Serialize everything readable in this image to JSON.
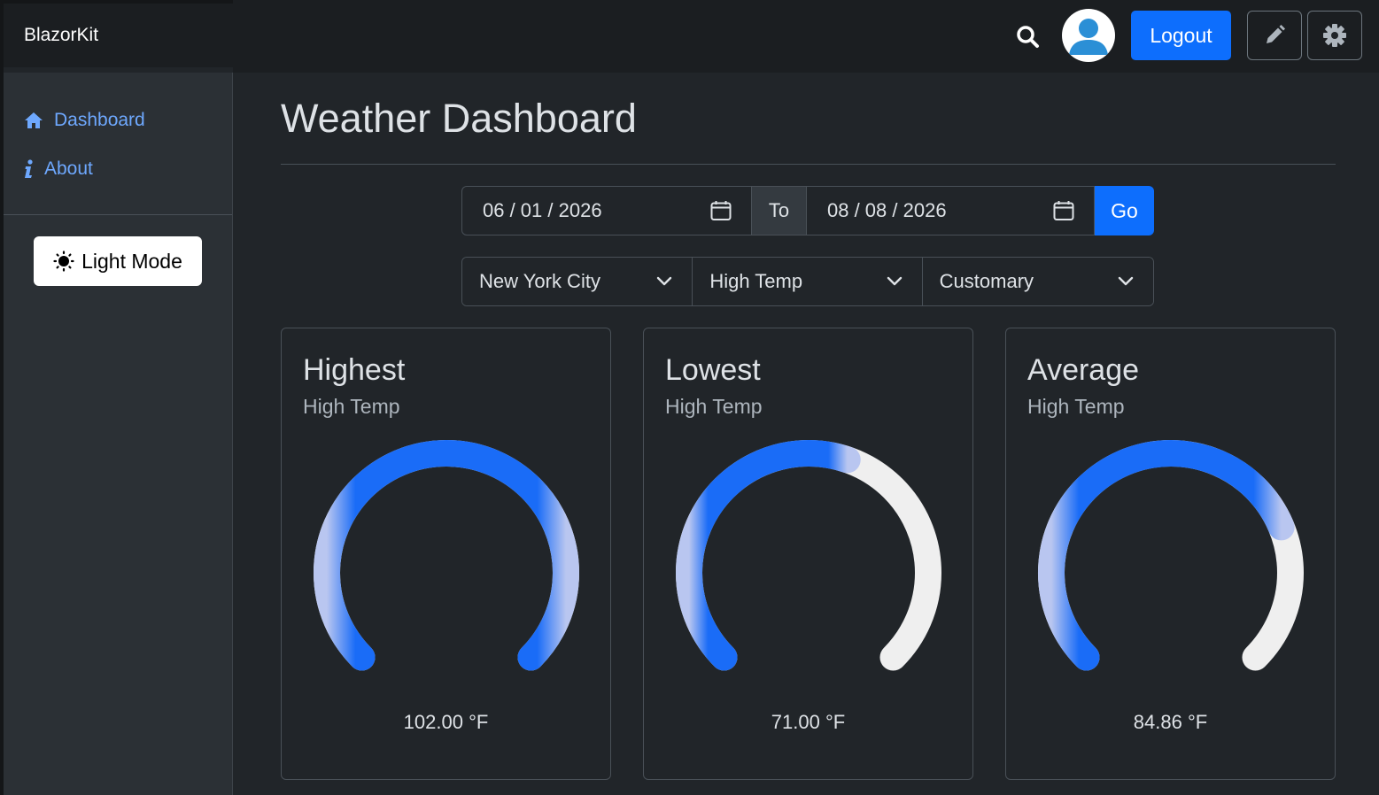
{
  "app": {
    "brand": "BlazorKit"
  },
  "header": {
    "logout_label": "Logout"
  },
  "sidebar": {
    "items": [
      {
        "label": "Dashboard",
        "icon": "home-icon"
      },
      {
        "label": "About",
        "icon": "info-icon"
      }
    ],
    "theme_toggle_label": "Light Mode"
  },
  "main": {
    "title": "Weather Dashboard",
    "date_from": "06 / 01 / 2026",
    "date_to_label": "To",
    "date_to": "08 / 08 / 2026",
    "go_label": "Go",
    "selects": {
      "city": "New York City",
      "metric": "High Temp",
      "units": "Customary"
    },
    "cards": [
      {
        "title": "Highest",
        "subtitle": "High Temp",
        "value_text": "102.00 °F",
        "fill": 1.0
      },
      {
        "title": "Lowest",
        "subtitle": "High Temp",
        "value_text": "71.00 °F",
        "fill": 0.57
      },
      {
        "title": "Average",
        "subtitle": "High Temp",
        "value_text": "84.86 °F",
        "fill": 0.75
      }
    ]
  },
  "colors": {
    "accent": "#0d6efd",
    "link": "#6ea8fe",
    "gauge_track": "#efefef",
    "background": "#212529"
  }
}
